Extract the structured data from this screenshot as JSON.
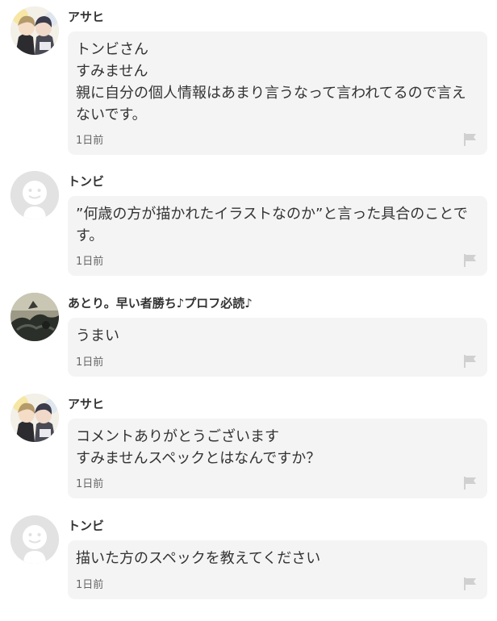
{
  "comments": [
    {
      "author": "アサヒ",
      "text": "トンビさん\nすみません\n親に自分の個人情報はあまり言うなって言われてるので言えないです。",
      "time": "1日前",
      "avatar": "illustration-avatar-1"
    },
    {
      "author": "トンビ",
      "text": "”何歳の方が描かれたイラストなのか”と言った具合のことです。",
      "time": "1日前",
      "avatar": "default-avatar"
    },
    {
      "author": "あとり。早い者勝ち♪プロフ必読♪",
      "text": "うまい",
      "time": "1日前",
      "avatar": "dark-illustration-avatar"
    },
    {
      "author": "アサヒ",
      "text": "コメントありがとうございます\nすみませんスペックとはなんですか？",
      "time": "1日前",
      "avatar": "illustration-avatar-1"
    },
    {
      "author": "トンビ",
      "text": "描いた方のスペックを教えてください",
      "time": "1日前",
      "avatar": "default-avatar"
    }
  ],
  "colors": {
    "bubble_bg": "#f4f4f4",
    "text": "#333333",
    "meta": "#666666",
    "flag_icon": "#d0d0d0",
    "default_avatar_bg": "#e2e2e2"
  }
}
